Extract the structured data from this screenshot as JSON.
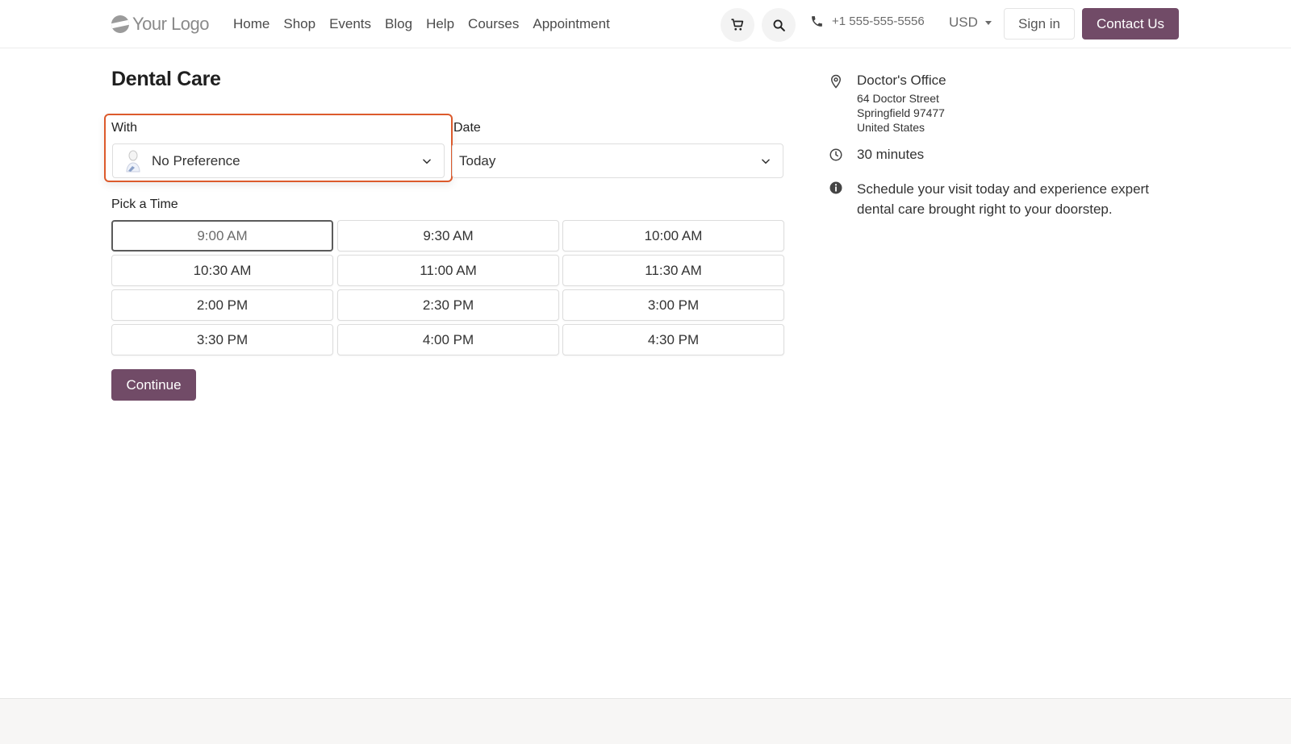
{
  "header": {
    "logo_text": "Your Logo",
    "nav": [
      "Home",
      "Shop",
      "Events",
      "Blog",
      "Help",
      "Courses",
      "Appointment"
    ],
    "phone": "+1 555-555-5556",
    "currency": "USD",
    "sign_in": "Sign in",
    "contact": "Contact Us"
  },
  "main": {
    "title": "Dental Care",
    "with_label": "With",
    "with_value": "No Preference",
    "date_label": "Date",
    "date_value": "Today",
    "pick_label": "Pick a Time",
    "slots": [
      "9:00 AM",
      "9:30 AM",
      "10:00 AM",
      "10:30 AM",
      "11:00 AM",
      "11:30 AM",
      "2:00 PM",
      "2:30 PM",
      "3:00 PM",
      "3:30 PM",
      "4:00 PM",
      "4:30 PM"
    ],
    "selected_slot": "9:00 AM",
    "continue": "Continue"
  },
  "sidebar": {
    "office_name": "Doctor's Office",
    "address": [
      "64 Doctor Street",
      "Springfield 97477",
      "United States"
    ],
    "duration": "30 minutes",
    "description": "Schedule your visit today and experience expert dental care brought right to your doorstep."
  },
  "colors": {
    "brand": "#714b67",
    "highlight": "#dc5a2c"
  }
}
